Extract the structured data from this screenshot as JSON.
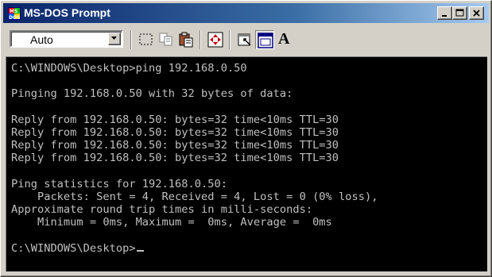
{
  "window": {
    "title": "MS-DOS Prompt",
    "icon": "ms-dos-icon",
    "buttons": [
      "minimize-icon",
      "maximize-icon",
      "close-icon"
    ]
  },
  "toolbar": {
    "font_size_value": "Auto",
    "tools": [
      "mark-icon",
      "copy-icon",
      "paste-icon",
      "full-screen-icon",
      "properties-icon",
      "background-icon",
      "font-icon"
    ],
    "font_tool_label": "A"
  },
  "console": {
    "lines": [
      "C:\\WINDOWS\\Desktop>ping 192.168.0.50",
      "",
      "Pinging 192.168.0.50 with 32 bytes of data:",
      "",
      "Reply from 192.168.0.50: bytes=32 time<10ms TTL=30",
      "Reply from 192.168.0.50: bytes=32 time<10ms TTL=30",
      "Reply from 192.168.0.50: bytes=32 time<10ms TTL=30",
      "Reply from 192.168.0.50: bytes=32 time<10ms TTL=30",
      "",
      "Ping statistics for 192.168.0.50:",
      "    Packets: Sent = 4, Received = 4, Lost = 0 (0% loss),",
      "Approximate round trip times in milli-seconds:",
      "    Minimum = 0ms, Maximum =  0ms, Average =  0ms",
      "",
      "C:\\WINDOWS\\Desktop>"
    ]
  },
  "colors": {
    "console_bg": "#000000",
    "console_fg": "#c0c0c0",
    "titlebar_start": "#0a246a",
    "titlebar_end": "#a6caf0",
    "chrome": "#d4d0c8"
  }
}
